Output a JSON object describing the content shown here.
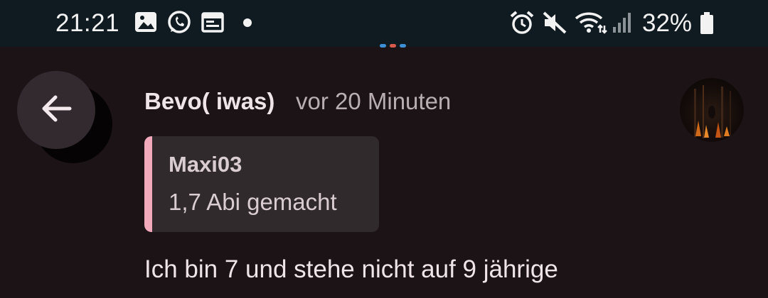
{
  "status_bar": {
    "time": "21:21",
    "left_icons": [
      "gallery-icon",
      "whatsapp-icon",
      "calendar-icon",
      "notification-dot-icon"
    ],
    "right_icons": [
      "alarm-icon",
      "mute-icon",
      "wifi-icon",
      "signal-icon",
      "battery-icon"
    ],
    "battery_percent": "32%"
  },
  "post": {
    "author": "Bevo( iwas)",
    "time_ago": "vor 20 Minuten",
    "quote": {
      "author": "Maxi03",
      "text": "1,7 Abi gemacht"
    },
    "message": "Ich bin 7 und stehe nicht auf 9 jährige"
  },
  "colors": {
    "background": "#1c1317",
    "status_bar": "#0f1a21",
    "quote_accent": "#f2a9bb",
    "quote_background": "#302a2c",
    "back_button": "#322a2e"
  }
}
